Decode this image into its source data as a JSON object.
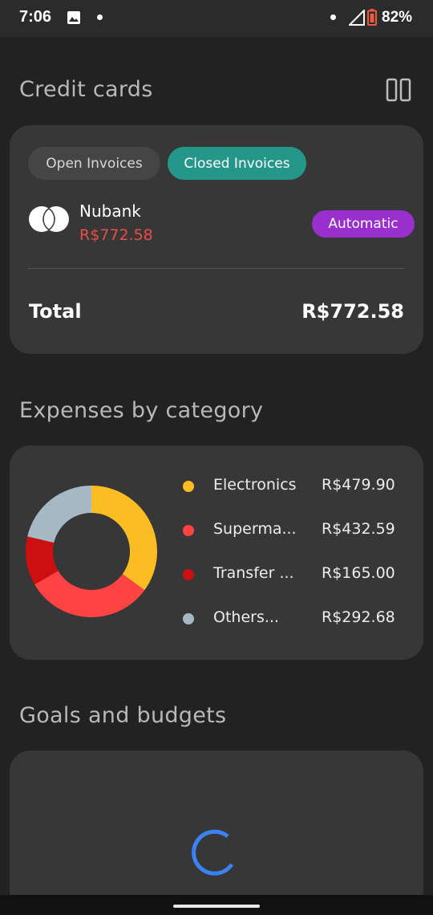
{
  "status_bar": {
    "time": "7:06",
    "battery": "82%",
    "icons": [
      "gallery-icon",
      "notification-dot",
      "signal-icon",
      "battery-icon"
    ]
  },
  "credit_cards": {
    "title": "Credit cards",
    "toggle_icon": "columns-icon",
    "tabs": [
      {
        "label": "Open Invoices",
        "selected": false
      },
      {
        "label": "Closed Invoices",
        "selected": true
      }
    ],
    "card": {
      "name": "Nubank",
      "amount": "R$772.58",
      "badge": "Automatic",
      "logo_icon": "mastercard-logo-icon"
    },
    "total_label": "Total",
    "total_value": "R$772.58"
  },
  "expenses": {
    "title": "Expenses by category",
    "categories": [
      {
        "label": "Electronics",
        "value": "R$479.90",
        "color": "#fbbd23"
      },
      {
        "label": "Superma...",
        "value": "R$432.59",
        "color": "#ff4343"
      },
      {
        "label": "Transfer ...",
        "value": "R$165.00",
        "color": "#cc0f0f"
      },
      {
        "label": "Others...",
        "value": "R$292.68",
        "color": "#a6b8c4"
      }
    ]
  },
  "chart_data": {
    "type": "pie",
    "categories": [
      "Electronics",
      "Superma...",
      "Transfer ...",
      "Others..."
    ],
    "values": [
      479.9,
      432.59,
      165.0,
      292.68
    ],
    "colors": [
      "#fbbd23",
      "#ff4343",
      "#cc0f0f",
      "#a6b8c4"
    ],
    "donut": true
  },
  "goals": {
    "title": "Goals and budgets",
    "loading_icon": "loading-spinner-icon"
  },
  "colors": {
    "background": "#222222",
    "card": "#373737",
    "accent_teal": "#25978a",
    "badge_purple": "#9a2fcf",
    "amount_red": "#e94e43",
    "spinner_blue": "#3b82f6"
  }
}
